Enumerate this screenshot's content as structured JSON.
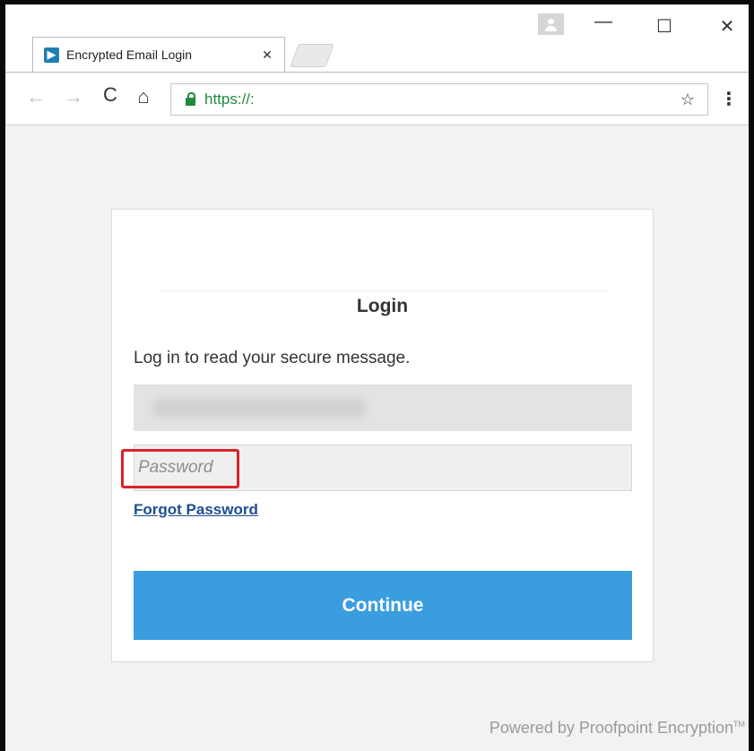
{
  "browser": {
    "tab_title": "Encrypted Email Login",
    "tab_close": "✕",
    "url": "https://:",
    "favicon_glyph": "▶",
    "window_controls": {
      "minimize": "—",
      "maximize": "☐",
      "close": "✕"
    },
    "nav": {
      "back": "←",
      "forward": "→",
      "reload": "C",
      "home": "⌂",
      "star": "☆",
      "menu": "⋮"
    }
  },
  "login": {
    "title": "Login",
    "subtitle": "Log in to read your secure message.",
    "email_value": "",
    "password_placeholder": "Password",
    "forgot_password": "Forgot Password",
    "continue_label": "Continue"
  },
  "footer": {
    "text": "Powered by Proofpoint Encryption",
    "trademark": "TM"
  },
  "colors": {
    "accent": "#3a9de0",
    "link": "#1d4e8f",
    "highlight": "#d9232a",
    "secure": "#1f8b3a"
  }
}
